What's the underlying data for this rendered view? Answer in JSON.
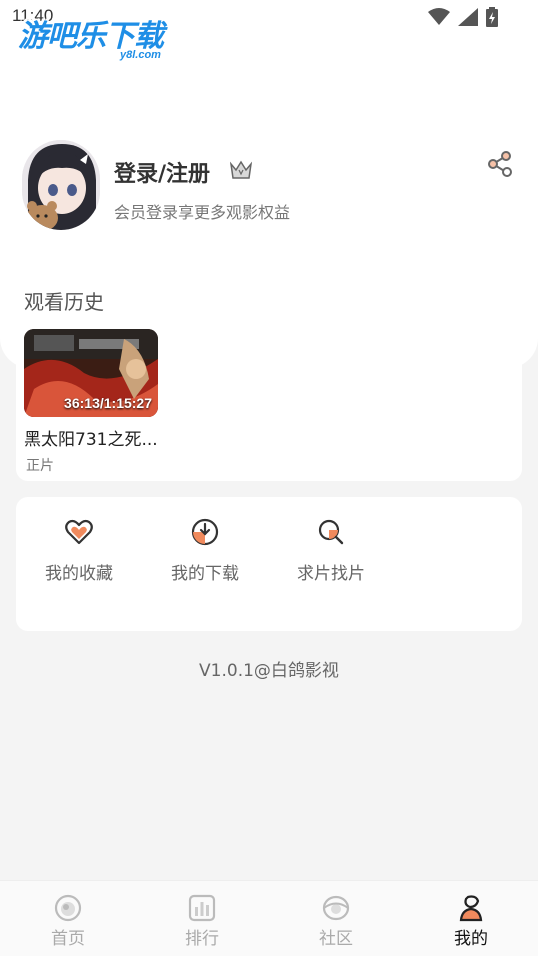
{
  "status": {
    "time": "11:40"
  },
  "watermark": {
    "main": "游吧乐下载",
    "sub": "y8l.com"
  },
  "profile": {
    "title": "登录/注册",
    "subtitle": "会员登录享更多观影权益"
  },
  "history": {
    "title": "观看历史",
    "items": [
      {
        "title": "黑太阳731之死...",
        "tag": "正片",
        "progress": "36:13/1:15:27"
      }
    ]
  },
  "menu": {
    "items": [
      {
        "label": "我的收藏",
        "icon": "heart-icon"
      },
      {
        "label": "我的下载",
        "icon": "download-icon"
      },
      {
        "label": "求片找片",
        "icon": "search-icon"
      }
    ]
  },
  "version": "V1.0.1@白鸽影视",
  "tabs": [
    {
      "label": "首页",
      "icon": "home-icon",
      "active": false
    },
    {
      "label": "排行",
      "icon": "ranking-icon",
      "active": false
    },
    {
      "label": "社区",
      "icon": "community-icon",
      "active": false
    },
    {
      "label": "我的",
      "icon": "profile-icon",
      "active": true
    }
  ],
  "colors": {
    "accent": "#f08a5d",
    "brand_watermark": "#1e8ee6"
  }
}
